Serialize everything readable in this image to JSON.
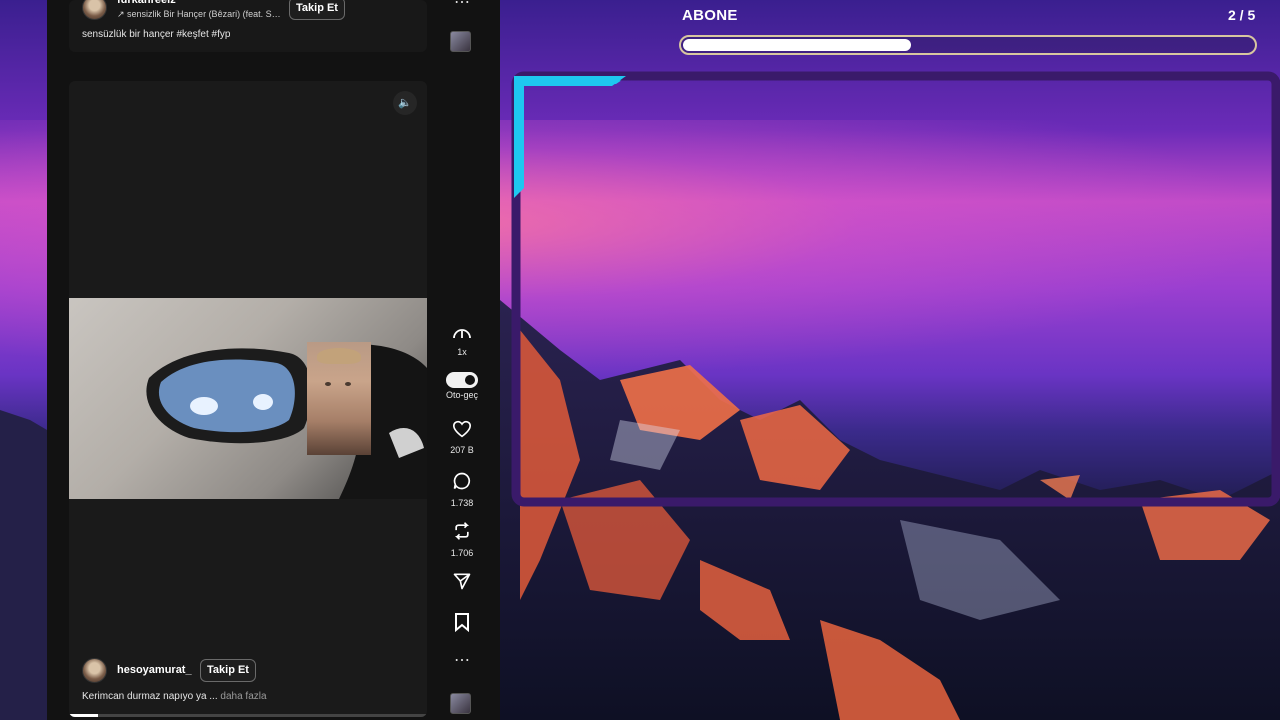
{
  "colors": {
    "feed_bg": "#121212",
    "overlay_accent": "#1ec8f0",
    "overlay_frame": "#3a1a6a",
    "progress_border": "#d8c6a0"
  },
  "feed": {
    "top_post": {
      "username": "furkanreelz",
      "music": "↗ sensizlik Bir Hançer (Bêzari) (feat. S…",
      "follow_label": "Takip Et",
      "caption": "sensüzlük bir hançer #keşfet #fyp"
    },
    "main_post": {
      "username": "hesoyamurat_",
      "follow_label": "Takip Et",
      "caption": "Kerimcan durmaz napıyo ya ...",
      "more_label": "daha fazla",
      "video_progress": 0.08
    }
  },
  "rail": {
    "top_more": "⋯",
    "speed_label": "1x",
    "autoplay_label": "Oto-geç",
    "likes": "207 B",
    "comments": "1.738",
    "reposts": "1.706",
    "more": "⋯"
  },
  "overlay": {
    "title": "ABONE",
    "count": "2 / 5",
    "progress": 0.4
  }
}
